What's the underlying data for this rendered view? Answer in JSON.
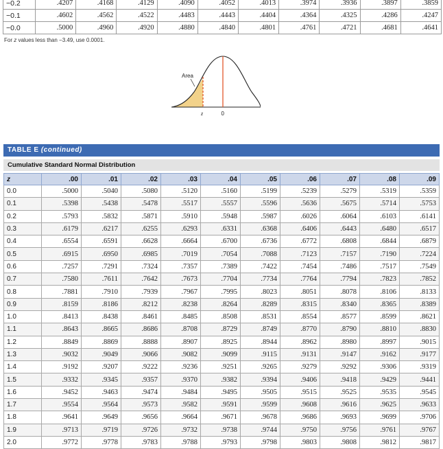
{
  "top_rows": [
    {
      "z": "−0.2",
      "values": [
        ".4207",
        ".4168",
        ".4129",
        ".4090",
        ".4052",
        ".4013",
        ".3974",
        ".3936",
        ".3897",
        ".3859"
      ]
    },
    {
      "z": "−0.1",
      "values": [
        ".4602",
        ".4562",
        ".4522",
        ".4483",
        ".4443",
        ".4404",
        ".4364",
        ".4325",
        ".4286",
        ".4247"
      ]
    },
    {
      "z": "−0.0",
      "values": [
        ".5000",
        ".4960",
        ".4920",
        ".4880",
        ".4840",
        ".4801",
        ".4761",
        ".4721",
        ".4681",
        ".4641"
      ]
    }
  ],
  "footnote": {
    "prefix": "For ",
    "var": "z",
    "suffix": " values less than −3.49, use 0.0001."
  },
  "figure": {
    "area_label": "Area",
    "z_label": "z",
    "zero_label": "0",
    "fill_color": "#f2d28a",
    "line_color": "#e2572b"
  },
  "table": {
    "title_main": "TABLE E ",
    "title_sub": "(continued)",
    "subtitle": "Cumulative Standard Normal Distribution",
    "header_color": "#3d6bb3",
    "columns": [
      "z",
      ".00",
      ".01",
      ".02",
      ".03",
      ".04",
      ".05",
      ".06",
      ".07",
      ".08",
      ".09"
    ],
    "rows": [
      {
        "z": "0.0",
        "values": [
          ".5000",
          ".5040",
          ".5080",
          ".5120",
          ".5160",
          ".5199",
          ".5239",
          ".5279",
          ".5319",
          ".5359"
        ]
      },
      {
        "z": "0.1",
        "values": [
          ".5398",
          ".5438",
          ".5478",
          ".5517",
          ".5557",
          ".5596",
          ".5636",
          ".5675",
          ".5714",
          ".5753"
        ]
      },
      {
        "z": "0.2",
        "values": [
          ".5793",
          ".5832",
          ".5871",
          ".5910",
          ".5948",
          ".5987",
          ".6026",
          ".6064",
          ".6103",
          ".6141"
        ]
      },
      {
        "z": "0.3",
        "values": [
          ".6179",
          ".6217",
          ".6255",
          ".6293",
          ".6331",
          ".6368",
          ".6406",
          ".6443",
          ".6480",
          ".6517"
        ]
      },
      {
        "z": "0.4",
        "values": [
          ".6554",
          ".6591",
          ".6628",
          ".6664",
          ".6700",
          ".6736",
          ".6772",
          ".6808",
          ".6844",
          ".6879"
        ]
      },
      {
        "z": "0.5",
        "values": [
          ".6915",
          ".6950",
          ".6985",
          ".7019",
          ".7054",
          ".7088",
          ".7123",
          ".7157",
          ".7190",
          ".7224"
        ]
      },
      {
        "z": "0.6",
        "values": [
          ".7257",
          ".7291",
          ".7324",
          ".7357",
          ".7389",
          ".7422",
          ".7454",
          ".7486",
          ".7517",
          ".7549"
        ]
      },
      {
        "z": "0.7",
        "values": [
          ".7580",
          ".7611",
          ".7642",
          ".7673",
          ".7704",
          ".7734",
          ".7764",
          ".7794",
          ".7823",
          ".7852"
        ]
      },
      {
        "z": "0.8",
        "values": [
          ".7881",
          ".7910",
          ".7939",
          ".7967",
          ".7995",
          ".8023",
          ".8051",
          ".8078",
          ".8106",
          ".8133"
        ]
      },
      {
        "z": "0.9",
        "values": [
          ".8159",
          ".8186",
          ".8212",
          ".8238",
          ".8264",
          ".8289",
          ".8315",
          ".8340",
          ".8365",
          ".8389"
        ]
      },
      {
        "z": "1.0",
        "values": [
          ".8413",
          ".8438",
          ".8461",
          ".8485",
          ".8508",
          ".8531",
          ".8554",
          ".8577",
          ".8599",
          ".8621"
        ]
      },
      {
        "z": "1.1",
        "values": [
          ".8643",
          ".8665",
          ".8686",
          ".8708",
          ".8729",
          ".8749",
          ".8770",
          ".8790",
          ".8810",
          ".8830"
        ]
      },
      {
        "z": "1.2",
        "values": [
          ".8849",
          ".8869",
          ".8888",
          ".8907",
          ".8925",
          ".8944",
          ".8962",
          ".8980",
          ".8997",
          ".9015"
        ]
      },
      {
        "z": "1.3",
        "values": [
          ".9032",
          ".9049",
          ".9066",
          ".9082",
          ".9099",
          ".9115",
          ".9131",
          ".9147",
          ".9162",
          ".9177"
        ]
      },
      {
        "z": "1.4",
        "values": [
          ".9192",
          ".9207",
          ".9222",
          ".9236",
          ".9251",
          ".9265",
          ".9279",
          ".9292",
          ".9306",
          ".9319"
        ]
      },
      {
        "z": "1.5",
        "values": [
          ".9332",
          ".9345",
          ".9357",
          ".9370",
          ".9382",
          ".9394",
          ".9406",
          ".9418",
          ".9429",
          ".9441"
        ]
      },
      {
        "z": "1.6",
        "values": [
          ".9452",
          ".9463",
          ".9474",
          ".9484",
          ".9495",
          ".9505",
          ".9515",
          ".9525",
          ".9535",
          ".9545"
        ]
      },
      {
        "z": "1.7",
        "values": [
          ".9554",
          ".9564",
          ".9573",
          ".9582",
          ".9591",
          ".9599",
          ".9608",
          ".9616",
          ".9625",
          ".9633"
        ]
      },
      {
        "z": "1.8",
        "values": [
          ".9641",
          ".9649",
          ".9656",
          ".9664",
          ".9671",
          ".9678",
          ".9686",
          ".9693",
          ".9699",
          ".9706"
        ]
      },
      {
        "z": "1.9",
        "values": [
          ".9713",
          ".9719",
          ".9726",
          ".9732",
          ".9738",
          ".9744",
          ".9750",
          ".9756",
          ".9761",
          ".9767"
        ]
      },
      {
        "z": "2.0",
        "values": [
          ".9772",
          ".9778",
          ".9783",
          ".9788",
          ".9793",
          ".9798",
          ".9803",
          ".9808",
          ".9812",
          ".9817"
        ]
      }
    ]
  }
}
